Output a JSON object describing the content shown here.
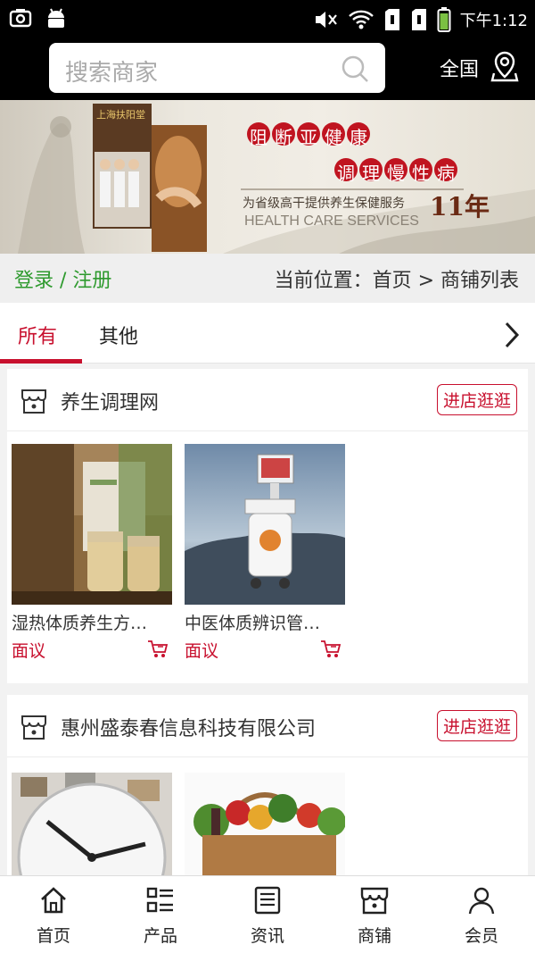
{
  "status_bar": {
    "time": "下午1:12"
  },
  "header": {
    "search_placeholder": "搜索商家",
    "region": "全国"
  },
  "banner": {
    "headline1": "阻断亚健康",
    "headline2": "调理慢性病",
    "tagline": "为省级高干提供养生保健服务",
    "years": "11年",
    "english": "HEALTH CARE SERVICES",
    "sign": "上海扶阳堂"
  },
  "crumb": {
    "login": "登录 / 注册",
    "location": "当前位置：首页 > 商铺列表"
  },
  "tabs": [
    {
      "label": "所有",
      "active": true
    },
    {
      "label": "其他",
      "active": false
    }
  ],
  "shops": [
    {
      "name": "养生调理网",
      "visit_label": "进店逛逛",
      "products": [
        {
          "name": "湿热体质养生方…",
          "price": "面议"
        },
        {
          "name": "中医体质辨识管…",
          "price": "面议"
        }
      ]
    },
    {
      "name": "惠州盛泰春信息科技有限公司",
      "visit_label": "进店逛逛",
      "products": [
        {
          "name": "",
          "price": ""
        },
        {
          "name": "",
          "price": ""
        }
      ]
    }
  ],
  "bottom_nav": [
    {
      "label": "首页",
      "icon": "home-icon"
    },
    {
      "label": "产品",
      "icon": "list-icon"
    },
    {
      "label": "资讯",
      "icon": "news-icon"
    },
    {
      "label": "商铺",
      "icon": "store-icon"
    },
    {
      "label": "会员",
      "icon": "user-icon"
    }
  ],
  "colors": {
    "accent": "#c8102e",
    "login_green": "#2e9a2e",
    "header_bg": "#000000"
  }
}
